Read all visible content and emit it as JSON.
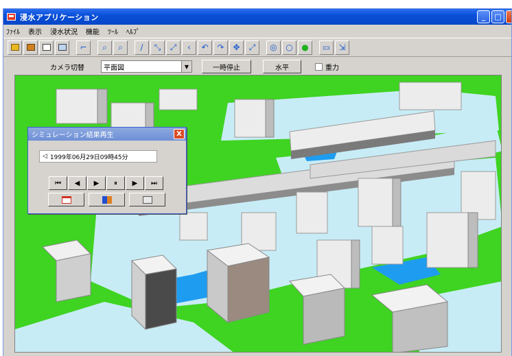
{
  "window": {
    "title": "浸水アプリケーション",
    "controls": {
      "minimize": "_",
      "maximize": "□",
      "close": "X"
    }
  },
  "menu": [
    "ﾌｧｲﾙ",
    "表示",
    "浸水状況",
    "機能",
    "ﾂｰﾙ",
    "ﾍﾙﾌﾟ"
  ],
  "toolbar": {
    "icons": [
      "folder-open-icon",
      "save-icon",
      "print-icon",
      "copy-icon",
      "pointer-icon",
      "zoom-in-icon",
      "zoom-out-icon",
      "pen-icon",
      "fit-icon",
      "expand-icon",
      "back-icon",
      "rotate-left-icon",
      "rotate-right-icon",
      "move-icon",
      "stretch-icon",
      "target-icon",
      "circle-icon",
      "green-dot-icon",
      "window-icon",
      "resize-icon"
    ],
    "glyphs": [
      "▰",
      "▰",
      "▤",
      "▣",
      "⌐",
      "⌕",
      "⌕",
      "∕",
      "⤡",
      "⤢",
      "‹",
      "↶",
      "↷",
      "✥",
      "⤢",
      "◎",
      "○",
      "●",
      "▭",
      "⇲"
    ]
  },
  "controls": {
    "camera_label": "カメラ切替",
    "camera_value": "平面図",
    "pause_button": "一時停止",
    "horizontal_button": "水平",
    "gravity_label": "重力",
    "gravity_checked": false
  },
  "dialog": {
    "title": "シミュレーション結果再生",
    "close": "X",
    "timestamp": "1999年06月29日09時45分",
    "playback": [
      "⏮",
      "◀",
      "▶",
      "⏸",
      "▶",
      "⏭"
    ],
    "playback_names": [
      "first-frame-button",
      "step-back-button",
      "play-button",
      "pause-button",
      "step-forward-button",
      "last-frame-button"
    ]
  },
  "colors": {
    "ground": "#3fd322",
    "water_light": "#c8ecf6",
    "water_deep": "#1e9cf0",
    "building": "#e2e2e2",
    "road": "#d9d9d9",
    "titlebar": "#0a4fd8"
  }
}
